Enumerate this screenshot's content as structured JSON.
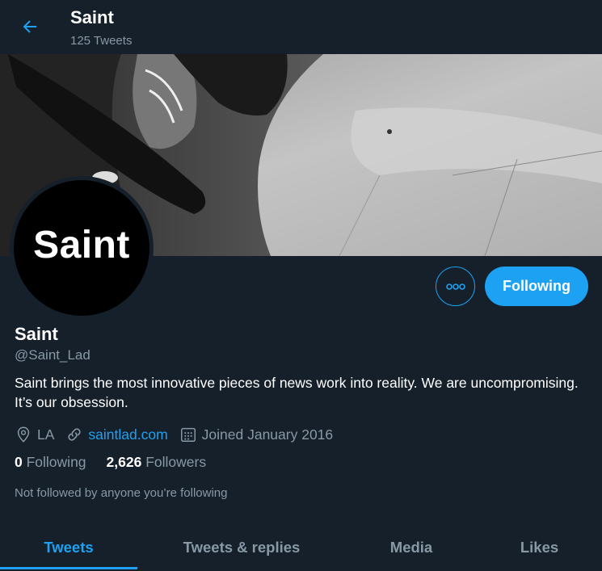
{
  "header": {
    "title": "Saint",
    "tweet_count": "125 Tweets"
  },
  "profile": {
    "avatar_text": "Saint",
    "name": "Saint",
    "handle": "@Saint_Lad",
    "bio": "Saint brings the most innovative pieces of news work into reality. We are uncompromising. It’s our obsession.",
    "location": "LA",
    "website": "saintlad.com",
    "joined": "Joined January 2016",
    "following_count": "0",
    "following_label": "Following",
    "followers_count": "2,626",
    "followers_label": "Followers",
    "not_followed_text": "Not followed by anyone you’re following"
  },
  "actions": {
    "follow_label": "Following",
    "more_icon": "more-icon"
  },
  "tabs": [
    {
      "label": "Tweets",
      "active": true
    },
    {
      "label": "Tweets & replies",
      "active": false
    },
    {
      "label": "Media",
      "active": false
    },
    {
      "label": "Likes",
      "active": false
    }
  ],
  "colors": {
    "background": "#15202b",
    "accent": "#1da1f2",
    "secondary_text": "#8899a6"
  }
}
